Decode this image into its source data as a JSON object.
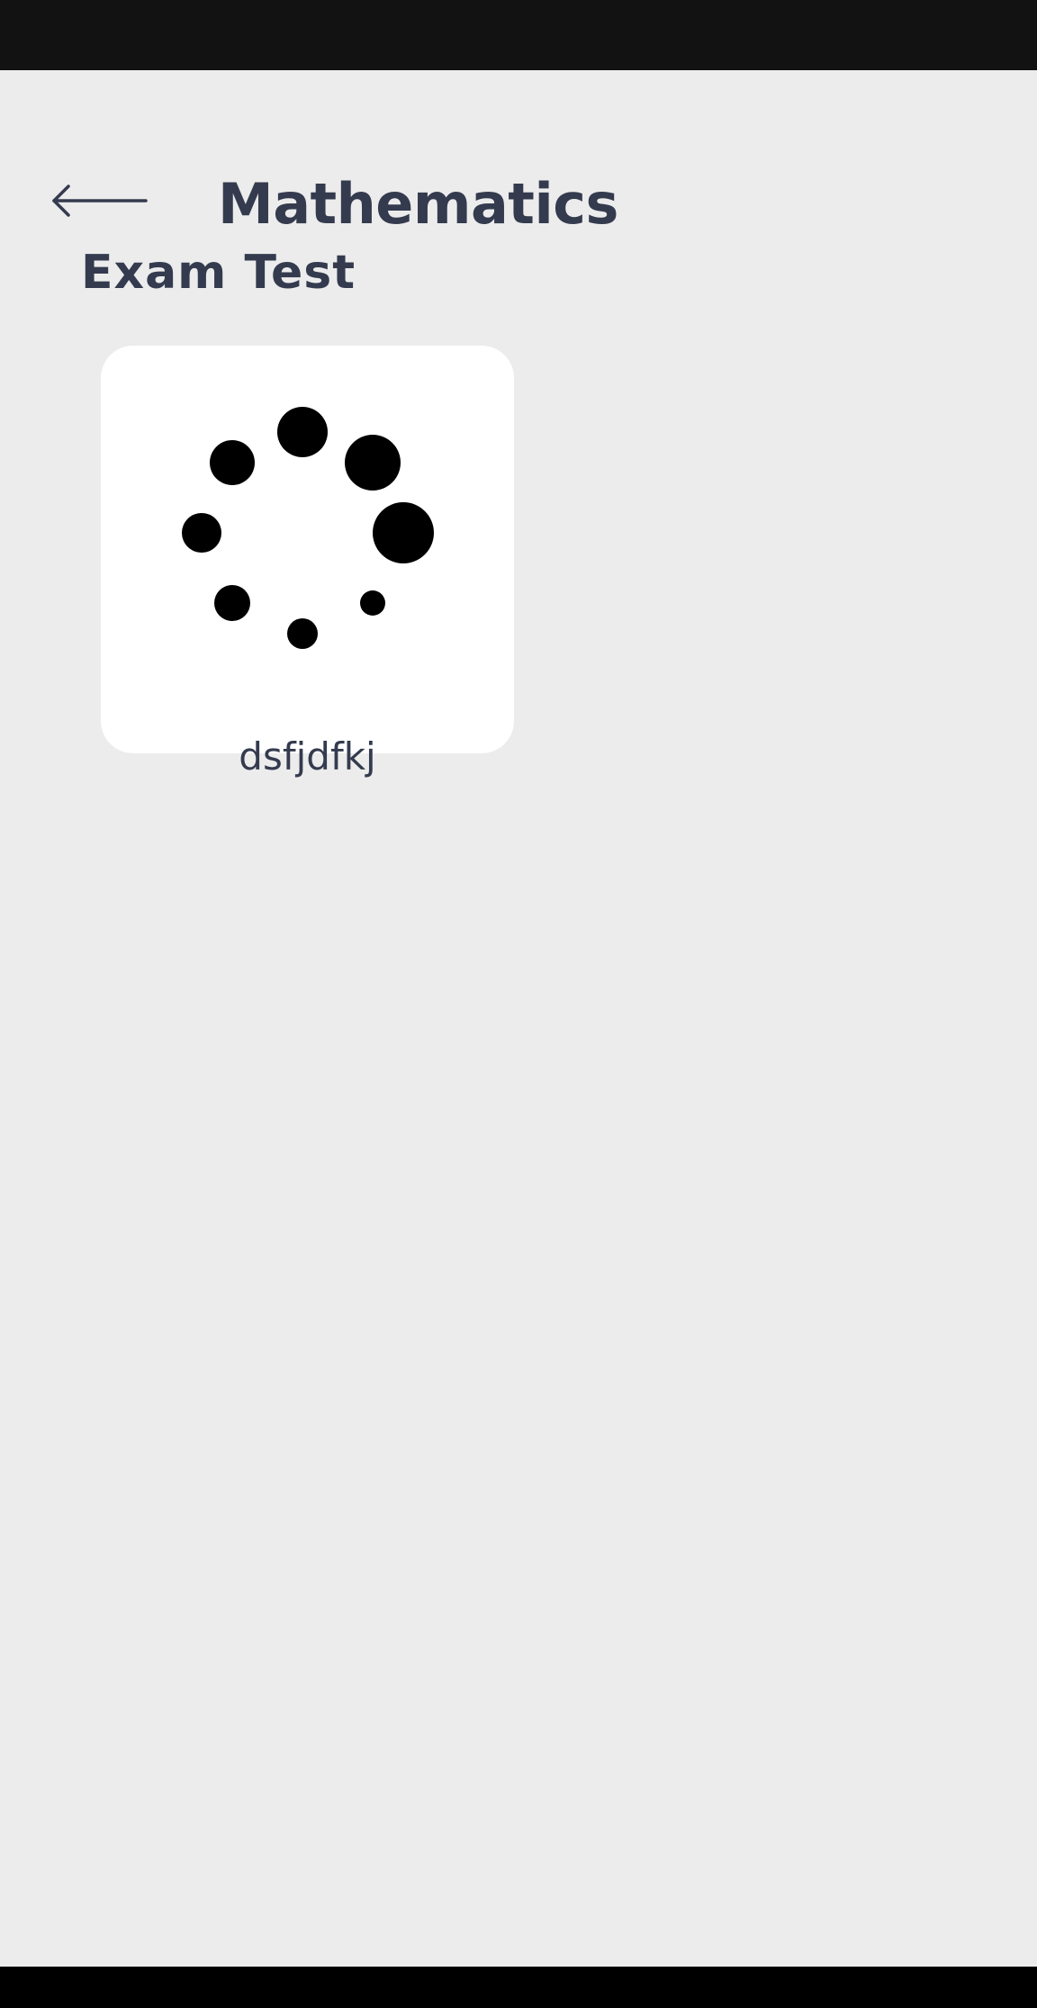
{
  "header": {
    "title": "Mathematics",
    "back_icon": "arrow-left-icon"
  },
  "section": {
    "heading": "Exam Test"
  },
  "exams": [
    {
      "label": "dsfjdfkj",
      "icon": "loading-dots-icon"
    }
  ],
  "colors": {
    "background": "#ececec",
    "text": "#343b4e",
    "card": "#ffffff",
    "status_bar": "#121212",
    "nav_bar": "#000000"
  }
}
